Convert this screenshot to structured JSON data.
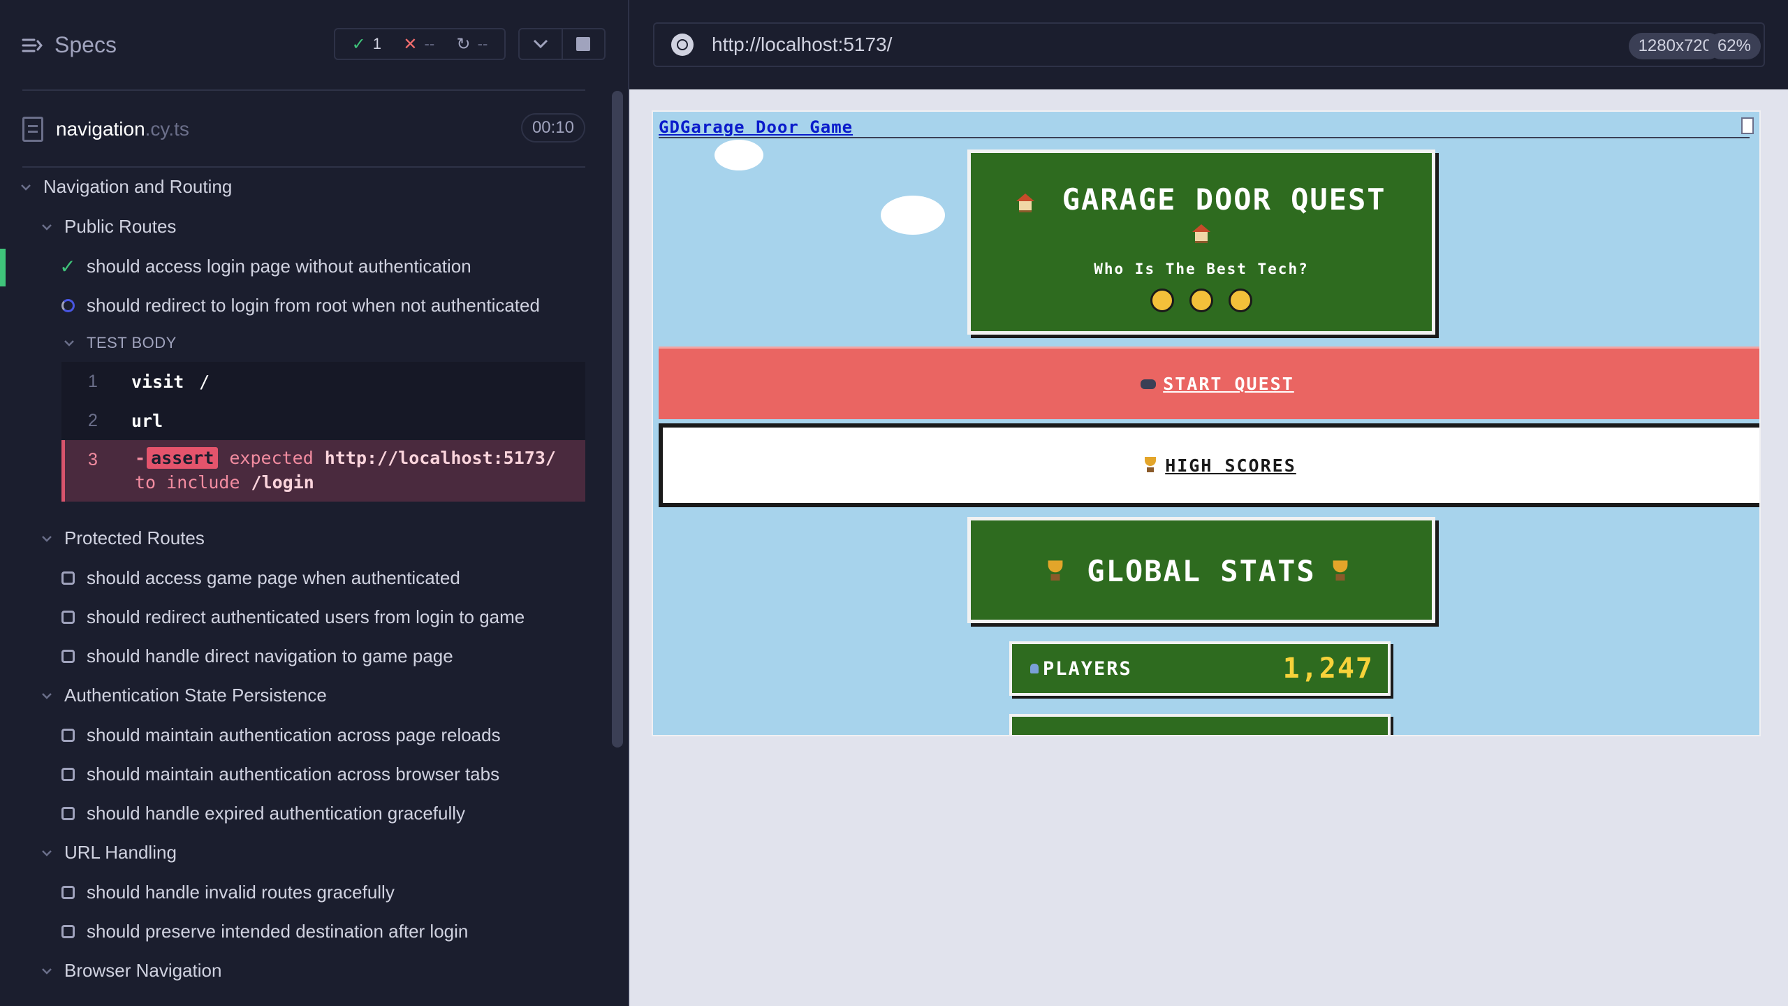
{
  "reporter": {
    "specs_label": "Specs",
    "stats": {
      "passed": "1",
      "failed": "--",
      "pending": "--"
    },
    "file": {
      "name": "navigation",
      "ext": ".cy.ts",
      "duration": "00:10"
    },
    "suite_title": "Navigation and Routing",
    "groups": {
      "public": {
        "title": "Public Routes",
        "t1": "should access login page without authentication",
        "t2": "should redirect to login from root when not authenticated"
      },
      "protected": {
        "title": "Protected Routes",
        "t1": "should access game page when authenticated",
        "t2": "should redirect authenticated users from login to game",
        "t3": "should handle direct navigation to game page"
      },
      "persistence": {
        "title": "Authentication State Persistence",
        "t1": "should maintain authentication across page reloads",
        "t2": "should maintain authentication across browser tabs",
        "t3": "should handle expired authentication gracefully"
      },
      "url": {
        "title": "URL Handling",
        "t1": "should handle invalid routes gracefully",
        "t2": "should preserve intended destination after login"
      },
      "browser": {
        "title": "Browser Navigation"
      }
    },
    "test_body": {
      "label": "TEST BODY",
      "cmd1": {
        "num": "1",
        "name": "visit",
        "arg": "/"
      },
      "cmd2": {
        "num": "2",
        "name": "url"
      },
      "cmd3": {
        "num": "3",
        "dash": "-",
        "name": "assert",
        "expected": "expected",
        "url": "http://localhost:5173/",
        "to_include": "to include",
        "path": "/login"
      }
    }
  },
  "aut": {
    "url": "http://localhost:5173/",
    "viewport_size": "1280x720",
    "zoom": "62%"
  },
  "site": {
    "header_link": "GDGarage Door Game",
    "title": "GARAGE DOOR QUEST",
    "subtitle": "Who Is The Best Tech?",
    "start_button": "START QUEST",
    "scores_button": "HIGH SCORES",
    "stats_title": "GLOBAL STATS",
    "players_label": "PLAYERS",
    "players_value": "1,247"
  },
  "colors": {
    "pass": "#3fc47a",
    "fail": "#f26d6d",
    "start_button": "#ea6562",
    "panel_green": "#2e6b1f",
    "sky": "#a7d3ec"
  }
}
